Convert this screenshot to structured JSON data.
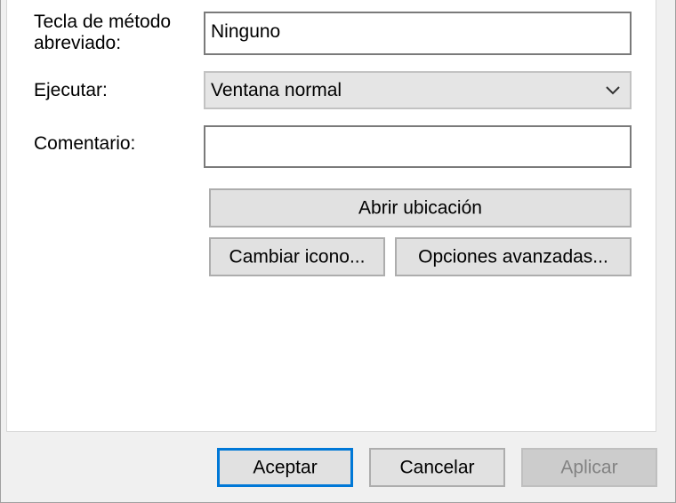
{
  "dialog": {
    "fields": {
      "shortcut_key": {
        "label": "Tecla de método\nabreviado:",
        "value": "Ninguno"
      },
      "run": {
        "label": "Ejecutar:",
        "selected": "Ventana normal"
      },
      "comment": {
        "label": "Comentario:",
        "value": ""
      }
    },
    "buttons": {
      "open_location": "Abrir ubicación",
      "change_icon": "Cambiar icono...",
      "advanced": "Opciones avanzadas..."
    },
    "footer": {
      "ok": "Aceptar",
      "cancel": "Cancelar",
      "apply": "Aplicar"
    }
  },
  "icons": {
    "combo_arrow": "chevron-down-icon"
  },
  "colors": {
    "panel_bg": "#ffffff",
    "dialog_bg": "#f0f0f0",
    "button_bg": "#e1e1e1",
    "default_button_border": "#0078d7",
    "disabled_text": "#838383"
  }
}
